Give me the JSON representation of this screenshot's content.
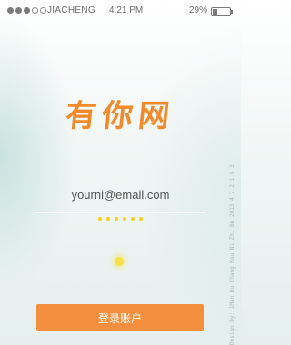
{
  "status_bar": {
    "carrier": "JIACHENG",
    "time": "4:21 PM",
    "battery_text": "29%",
    "battery_level": 0.29,
    "signal_bars_filled": 3,
    "signal_bars_total": 5
  },
  "logo": {
    "text": "有你网",
    "color": "#f08a2a"
  },
  "login_form": {
    "email_value": "yourni@email.com",
    "password_dots": 6,
    "login_button_label": "登录账户"
  },
  "colors": {
    "accent": "#f48f3f",
    "password_dot": "#f5d11b"
  },
  "watermark": "Design by: 1Man Bu Chang Kou Ni Zhi Bu 2013 4 2 2 1 5 3"
}
